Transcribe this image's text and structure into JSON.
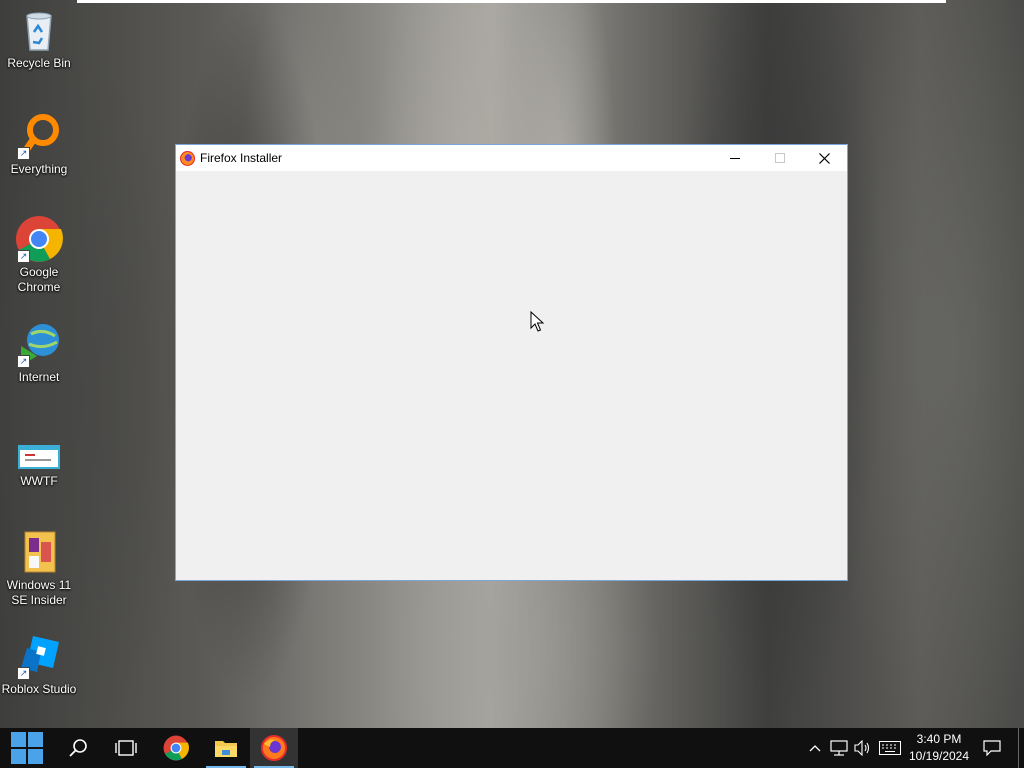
{
  "desktop": {
    "icons": [
      {
        "label": "Recycle Bin",
        "icon": "recycle-bin-icon"
      },
      {
        "label": "Everything",
        "icon": "everything-search-icon"
      },
      {
        "label": "Google Chrome",
        "icon": "chrome-icon"
      },
      {
        "label": "Internet",
        "icon": "internet-download-icon"
      },
      {
        "label": "WWTF",
        "icon": "wwtf-app-icon"
      },
      {
        "label": "Windows 11 SE Insider",
        "icon": "windows-insider-folder-icon"
      },
      {
        "label": "Roblox Studio",
        "icon": "roblox-studio-icon"
      }
    ]
  },
  "window": {
    "title": "Firefox Installer",
    "icon": "firefox-icon",
    "controls": [
      "minimize",
      "maximize",
      "close"
    ],
    "accent_border": "#7aa7d8",
    "client_background": "#f0f0f0"
  },
  "taskbar": {
    "background": "#101010",
    "items": [
      {
        "name": "start",
        "icon": "windows-start-icon"
      },
      {
        "name": "search",
        "icon": "search-icon"
      },
      {
        "name": "task-view",
        "icon": "task-view-icon"
      },
      {
        "name": "chrome",
        "icon": "chrome-icon"
      },
      {
        "name": "file-explorer",
        "icon": "folder-icon",
        "running": true
      },
      {
        "name": "firefox",
        "icon": "firefox-icon",
        "running": true,
        "active": true
      }
    ],
    "tray": {
      "icons": [
        "chevron-up-icon",
        "network-icon",
        "volume-icon",
        "keyboard-icon",
        "notification-icon"
      ],
      "time": "3:40 PM",
      "date": "10/19/2024"
    }
  }
}
